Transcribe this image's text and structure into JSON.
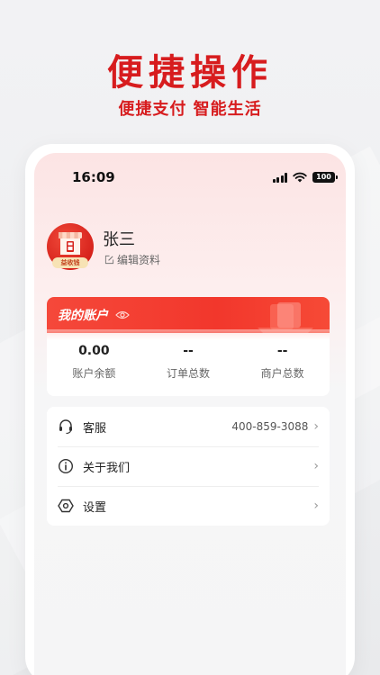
{
  "promo": {
    "headline": "便捷操作",
    "subline": "便捷支付 智能生活"
  },
  "status_bar": {
    "time": "16:09",
    "battery": "100"
  },
  "profile": {
    "name": "张三",
    "edit_label": "编辑资料",
    "avatar_tag": "益收钱"
  },
  "account": {
    "title": "我的账户",
    "stats": [
      {
        "value": "0.00",
        "label": "账户余额"
      },
      {
        "value": "--",
        "label": "订单总数"
      },
      {
        "value": "--",
        "label": "商户总数"
      }
    ]
  },
  "menu": {
    "items": [
      {
        "label": "客服",
        "value": "400-859-3088",
        "icon": "headset-icon"
      },
      {
        "label": "关于我们",
        "value": "",
        "icon": "info-icon"
      },
      {
        "label": "设置",
        "value": "",
        "icon": "settings-icon"
      }
    ]
  },
  "colors": {
    "brand_red": "#d71c1e",
    "card_header": "#f2372c"
  }
}
